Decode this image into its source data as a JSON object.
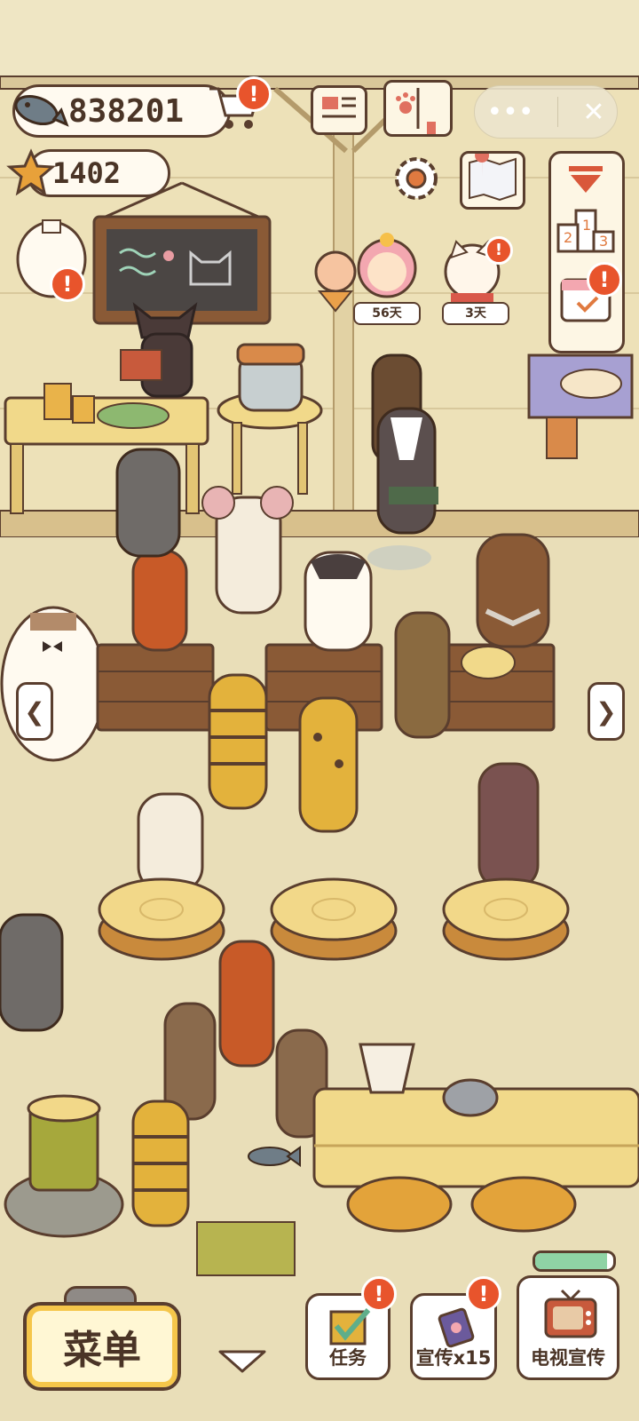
{
  "currencies": {
    "fish": "838201",
    "stars": "1402"
  },
  "guests": [
    {
      "name": "princess-guest",
      "days": "56天"
    },
    {
      "name": "lucky-cat-guest",
      "days": "3天"
    }
  ],
  "bottom_bar": {
    "menu_label": "菜单",
    "tasks_label": "任务",
    "promo_label": "宣传x15",
    "tv_promo_label": "电视宣传"
  },
  "energy": {
    "fill_fraction": 0.92
  },
  "icons": {
    "fish": "fish-icon",
    "star": "star-icon",
    "cart": "shop-cart-icon",
    "newspaper": "newspaper-icon",
    "paw_book": "paw-book-icon",
    "settings": "gear-icon",
    "map": "map-icon",
    "more": "more-dots-icon",
    "close": "close-icon",
    "ranking": "ranking-podium-icon",
    "calendar": "calendar-icon",
    "collapse": "collapse-triangle-icon",
    "tasks": "checkbox-icon",
    "promo": "flyer-icon",
    "tv": "tv-icon"
  },
  "colors": {
    "wall": "#efe6c4",
    "floor": "#e8ddb6",
    "wood": "#8a5a36",
    "outline": "#5a3e2e",
    "alert": "#e8542c",
    "menu_accent": "#f5c64a"
  }
}
